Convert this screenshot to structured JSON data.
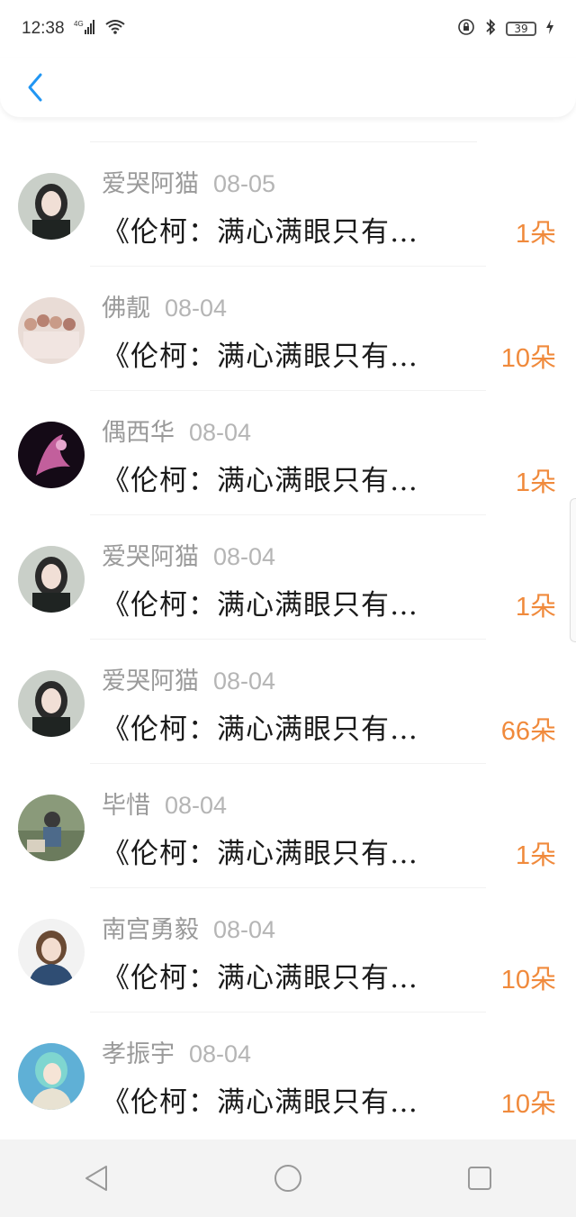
{
  "status_bar": {
    "time": "12:38",
    "network": "4G",
    "battery": "39",
    "icons": [
      "signal-icon",
      "wifi-icon",
      "lock-icon",
      "bluetooth-icon",
      "battery-icon",
      "charging-icon"
    ]
  },
  "header": {
    "back_icon": "back-arrow-icon",
    "accent": "#2196f3"
  },
  "list": {
    "items": [
      {
        "name": "爱哭阿猫",
        "date": "08-05",
        "message": "《伦柯：满心满眼只有…",
        "count": "1朵"
      },
      {
        "name": "佛靓",
        "date": "08-04",
        "message": "《伦柯：满心满眼只有…",
        "count": "10朵"
      },
      {
        "name": "偶西华",
        "date": "08-04",
        "message": "《伦柯：满心满眼只有…",
        "count": "1朵"
      },
      {
        "name": "爱哭阿猫",
        "date": "08-04",
        "message": "《伦柯：满心满眼只有…",
        "count": "1朵"
      },
      {
        "name": "爱哭阿猫",
        "date": "08-04",
        "message": "《伦柯：满心满眼只有…",
        "count": "66朵"
      },
      {
        "name": "毕惜",
        "date": "08-04",
        "message": "《伦柯：满心满眼只有…",
        "count": "1朵"
      },
      {
        "name": "南宫勇毅",
        "date": "08-04",
        "message": "《伦柯：满心满眼只有…",
        "count": "10朵"
      },
      {
        "name": "孝振宇",
        "date": "08-04",
        "message": "《伦柯：满心满眼只有…",
        "count": "10朵"
      }
    ]
  },
  "colors": {
    "count": "#f08a3c",
    "name": "#9a9a9a",
    "date": "#b5b5b5",
    "message": "#1a1a1a"
  },
  "nav_bar": {
    "icons": [
      "nav-back-icon",
      "nav-home-icon",
      "nav-recents-icon"
    ]
  }
}
